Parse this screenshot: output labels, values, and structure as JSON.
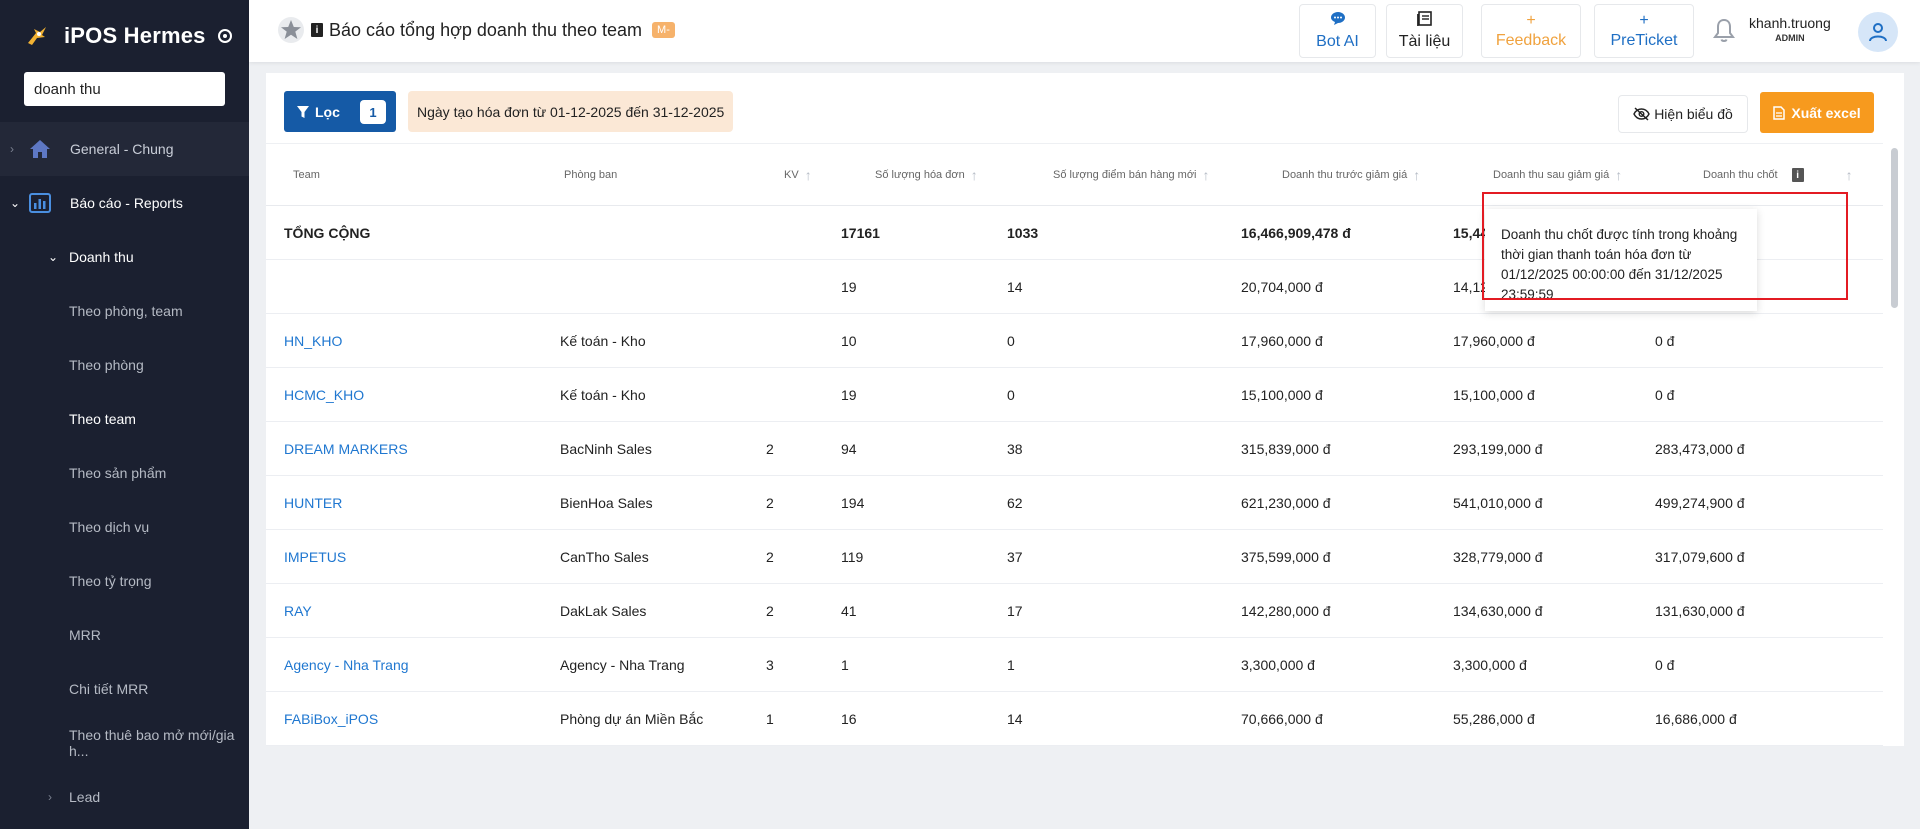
{
  "sidebar": {
    "app_name": "iPOS Hermes",
    "search_value": "doanh thu",
    "general_label": "General - Chung",
    "reports_label": "Báo cáo - Reports",
    "revenue_label": "Doanh thu",
    "sub_items": [
      "Theo phòng, team",
      "Theo phòng",
      "Theo team",
      "Theo sản phẩm",
      "Theo dịch vụ",
      "Theo tỷ trọng",
      "MRR",
      "Chi tiết MRR",
      "Theo thuê bao mở mới/gia h..."
    ],
    "lead_label": "Lead"
  },
  "header": {
    "title": "Báo cáo tổng hợp doanh thu theo team",
    "badge": "M-",
    "buttons": {
      "bot_ai": "Bot AI",
      "docs": "Tài liệu",
      "feedback": "Feedback",
      "preticket": "PreTicket"
    },
    "icons": {
      "bot_ai": "+",
      "feedback": "+",
      "preticket": "+"
    },
    "username": "khanh.truong",
    "role": "ADMIN"
  },
  "toolbar": {
    "filter_label": "Lọc",
    "filter_count": "1",
    "date_range": "Ngày tạo hóa đơn từ 01-12-2025 đến 31-12-2025",
    "chart_toggle": "Hiện biểu đồ",
    "export": "Xuất excel"
  },
  "table": {
    "columns": [
      "Team",
      "Phòng ban",
      "KV",
      "Số lượng hóa đơn",
      "Số lượng điểm bán hàng mới",
      "Doanh thu trước giảm giá",
      "Doanh thu sau giảm giá",
      "Doanh thu chốt"
    ],
    "total": {
      "label": "TỔNG CỘNG",
      "invoices": "17161",
      "new_points": "1033",
      "before_discount": "16,466,909,478 đ",
      "after_discount": "15,44"
    },
    "rows": [
      {
        "team": "",
        "dept": "",
        "kv": "",
        "invoices": "19",
        "new_points": "14",
        "before": "20,704,000 đ",
        "after": "14,12",
        "closed": "0 đ"
      },
      {
        "team": "HN_KHO",
        "dept": "Kế toán - Kho",
        "kv": "",
        "invoices": "10",
        "new_points": "0",
        "before": "17,960,000 đ",
        "after": "17,960,000 đ",
        "closed": "0 đ"
      },
      {
        "team": "HCMC_KHO",
        "dept": "Kế toán - Kho",
        "kv": "",
        "invoices": "19",
        "new_points": "0",
        "before": "15,100,000 đ",
        "after": "15,100,000 đ",
        "closed": "0 đ"
      },
      {
        "team": "DREAM MARKERS",
        "dept": "BacNinh Sales",
        "kv": "2",
        "invoices": "94",
        "new_points": "38",
        "before": "315,839,000 đ",
        "after": "293,199,000 đ",
        "closed": "283,473,000 đ"
      },
      {
        "team": "HUNTER",
        "dept": "BienHoa Sales",
        "kv": "2",
        "invoices": "194",
        "new_points": "62",
        "before": "621,230,000 đ",
        "after": "541,010,000 đ",
        "closed": "499,274,900 đ"
      },
      {
        "team": "IMPETUS",
        "dept": "CanTho Sales",
        "kv": "2",
        "invoices": "119",
        "new_points": "37",
        "before": "375,599,000 đ",
        "after": "328,779,000 đ",
        "closed": "317,079,600 đ"
      },
      {
        "team": "RAY",
        "dept": "DakLak Sales",
        "kv": "2",
        "invoices": "41",
        "new_points": "17",
        "before": "142,280,000 đ",
        "after": "134,630,000 đ",
        "closed": "131,630,000 đ"
      },
      {
        "team": "Agency - Nha Trang",
        "dept": "Agency - Nha Trang",
        "kv": "3",
        "invoices": "1",
        "new_points": "1",
        "before": "3,300,000 đ",
        "after": "3,300,000 đ",
        "closed": "0 đ"
      },
      {
        "team": "FABiBox_iPOS",
        "dept": "Phòng dự án Miền Bắc",
        "kv": "1",
        "invoices": "16",
        "new_points": "14",
        "before": "70,666,000 đ",
        "after": "55,286,000 đ",
        "closed": "16,686,000 đ"
      }
    ]
  },
  "tooltip": {
    "text": "Doanh thu chốt được tính trong khoảng thời gian thanh toán hóa đơn từ 01/12/2025 00:00:00 đến 31/12/2025 23:59:59"
  },
  "colors": {
    "sidebar_bg": "#1b2030",
    "primary": "#155aa6",
    "accent": "#f79a1e",
    "link": "#1f77d0",
    "highlight": "#e31b23"
  }
}
